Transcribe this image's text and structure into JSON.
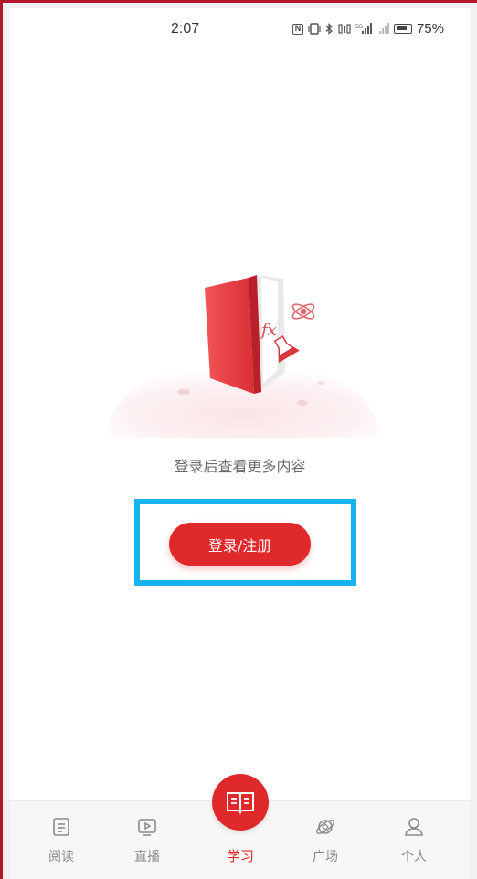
{
  "status_bar": {
    "time": "2:07",
    "battery_percent": "75%",
    "icons": [
      "nfc-icon",
      "vibrate-icon",
      "bluetooth-icon",
      "signal-icon",
      "signal-icon",
      "battery-icon"
    ]
  },
  "main": {
    "prompt": "登录后查看更多内容",
    "login_button_label": "登录/注册"
  },
  "bottom_nav": {
    "items": [
      {
        "label": "阅读",
        "icon": "read-icon"
      },
      {
        "label": "直播",
        "icon": "live-icon"
      },
      {
        "label": "学习",
        "icon": "study-icon",
        "active": true
      },
      {
        "label": "广场",
        "icon": "square-icon"
      },
      {
        "label": "个人",
        "icon": "person-icon"
      }
    ]
  },
  "colors": {
    "accent": "#e0292b",
    "highlight": "#16b4ee",
    "muted_text": "#8a8a8a"
  }
}
